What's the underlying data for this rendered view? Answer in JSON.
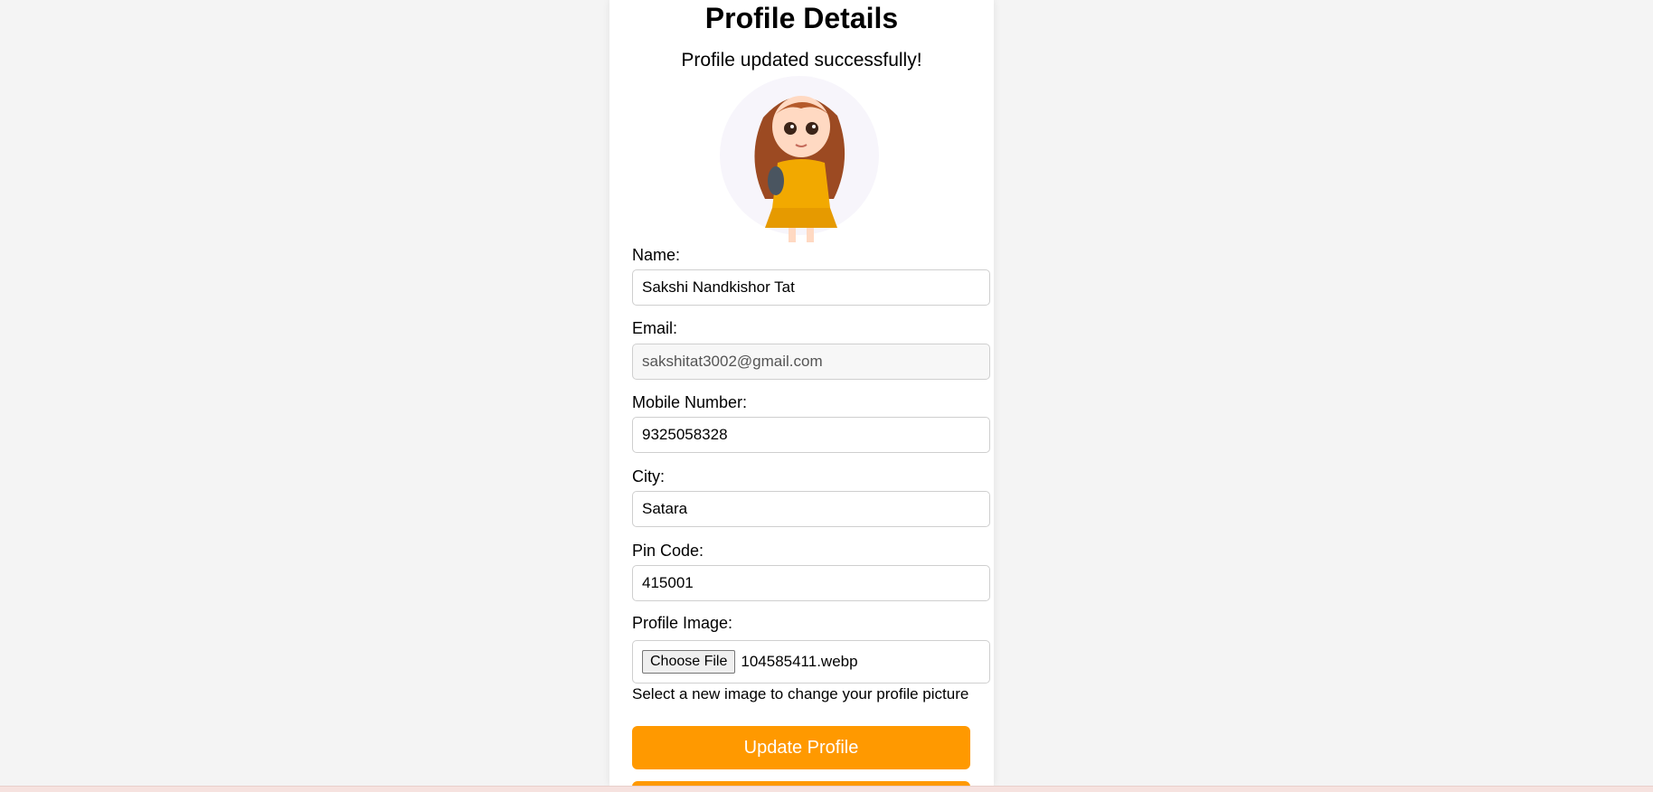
{
  "page": {
    "title": "Profile Details",
    "message": "Profile updated successfully!"
  },
  "form": {
    "name": {
      "label": "Name:",
      "value": "Sakshi Nandkishor Tat"
    },
    "email": {
      "label": "Email:",
      "value": "sakshitat3002@gmail.com"
    },
    "mobile": {
      "label": "Mobile Number:",
      "value": "9325058328"
    },
    "city": {
      "label": "City:",
      "value": "Satara"
    },
    "pincode": {
      "label": "Pin Code:",
      "value": "415001"
    },
    "image": {
      "label": "Profile Image:",
      "button_label": "Choose File",
      "file_name": "104585411.webp",
      "hint": "Select a new image to change your profile picture"
    }
  },
  "actions": {
    "update_label": "Update Profile"
  },
  "colors": {
    "accent": "#ff9900",
    "background": "#f4f4f4"
  },
  "icons": {
    "avatar": "profile-avatar-cartoon-girl"
  }
}
